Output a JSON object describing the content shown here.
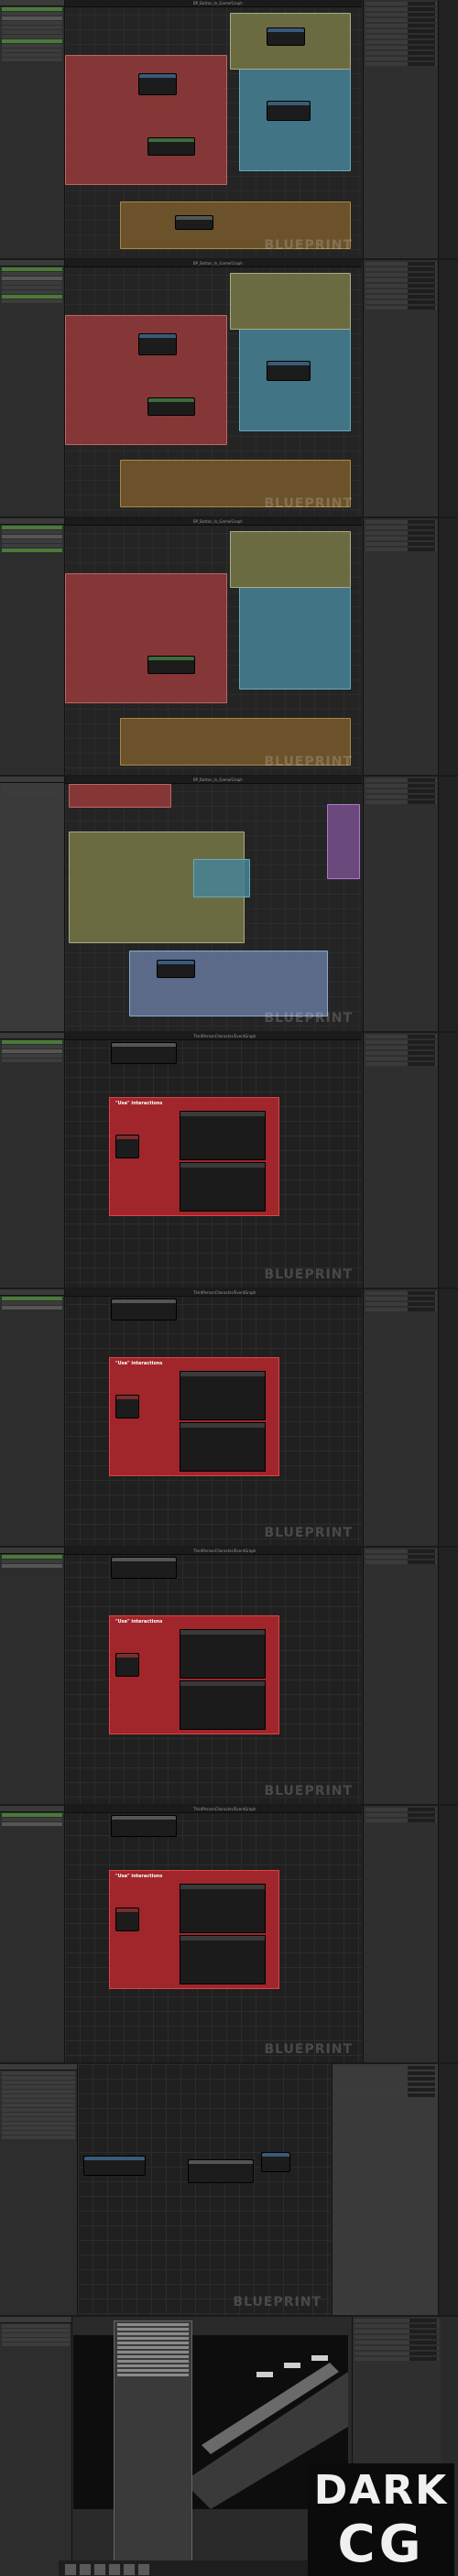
{
  "blueprint_label": "BLUEPRINT",
  "panels": [
    {
      "tab": "BP_Button_In_Game/Graph",
      "watermark": "BLUEPRINT"
    },
    {
      "tab": "BP_Button_In_Game/Graph",
      "watermark": "BLUEPRINT"
    },
    {
      "tab": "BP_Button_In_Game/Graph",
      "watermark": "BLUEPRINT"
    },
    {
      "tab": "BP_Button_In_Game/Graph",
      "watermark": "BLUEPRINT"
    },
    {
      "tab": "ThirdPersonCharacter/EventGraph",
      "watermark": "BLUEPRINT",
      "comment": "\"Use\" interactions"
    },
    {
      "tab": "ThirdPersonCharacter/EventGraph",
      "watermark": "BLUEPRINT",
      "comment": "\"Use\" interactions"
    },
    {
      "tab": "ThirdPersonCharacter/EventGraph",
      "watermark": "BLUEPRINT",
      "comment": "\"Use\" interactions"
    },
    {
      "tab": "ThirdPersonCharacter/EventGraph",
      "watermark": "BLUEPRINT",
      "comment": "\"Use\" interactions"
    },
    {
      "tab": "",
      "watermark": "BLUEPRINT"
    }
  ],
  "badge": {
    "line1": "DARK",
    "line2": "CG"
  },
  "colors": {
    "comment_red": "#a0262b",
    "accent_blue": "#4a86c8",
    "bg": "#242424"
  }
}
